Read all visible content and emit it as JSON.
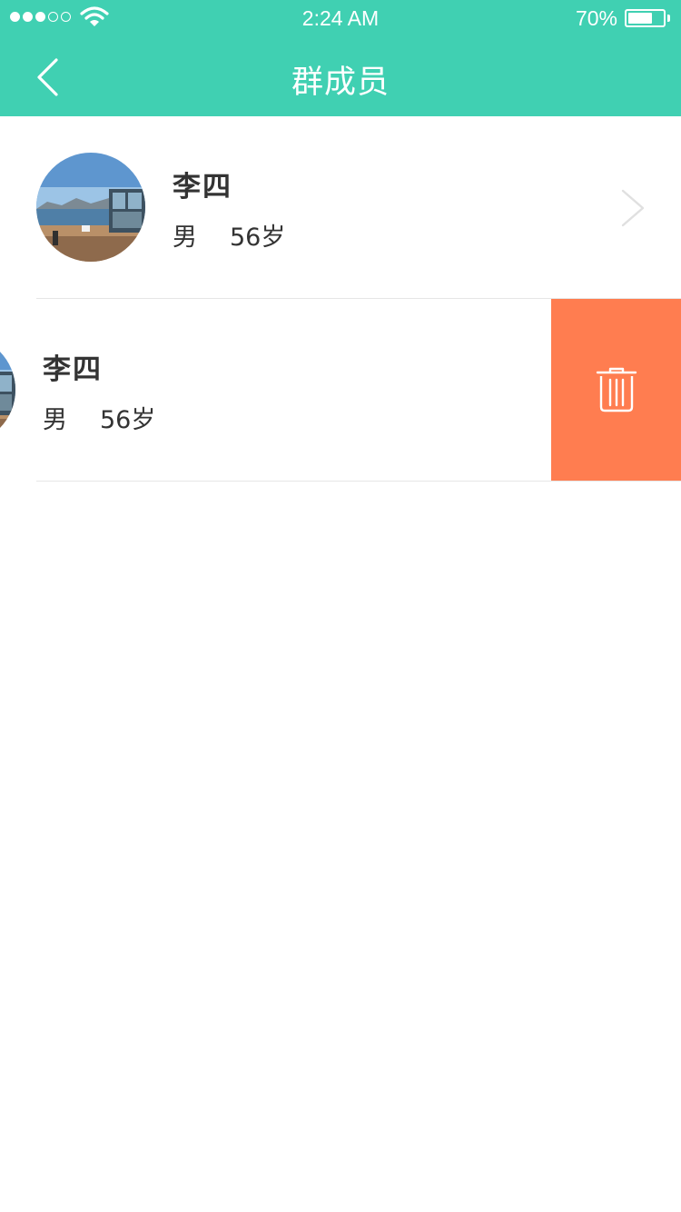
{
  "status_bar": {
    "time": "2:24 AM",
    "battery_percent": "70%",
    "battery_level": 0.7,
    "signal_bars_filled": 3,
    "signal_bars_total": 5
  },
  "nav": {
    "title": "群成员",
    "back_icon": "chevron-left-icon"
  },
  "members": [
    {
      "name": "李四",
      "gender": "男",
      "age": "56岁",
      "avatar_icon": "avatar-photo",
      "chevron_icon": "chevron-right-icon"
    },
    {
      "name": "李四",
      "gender": "男",
      "age": "56岁",
      "avatar_icon": "avatar-photo",
      "swiped_open": true,
      "action_icon": "trash-icon"
    }
  ],
  "colors": {
    "header_bg": "#40D0B2",
    "delete_bg": "#FF7D50",
    "text": "#333333",
    "divider": "#E6E6E6"
  }
}
